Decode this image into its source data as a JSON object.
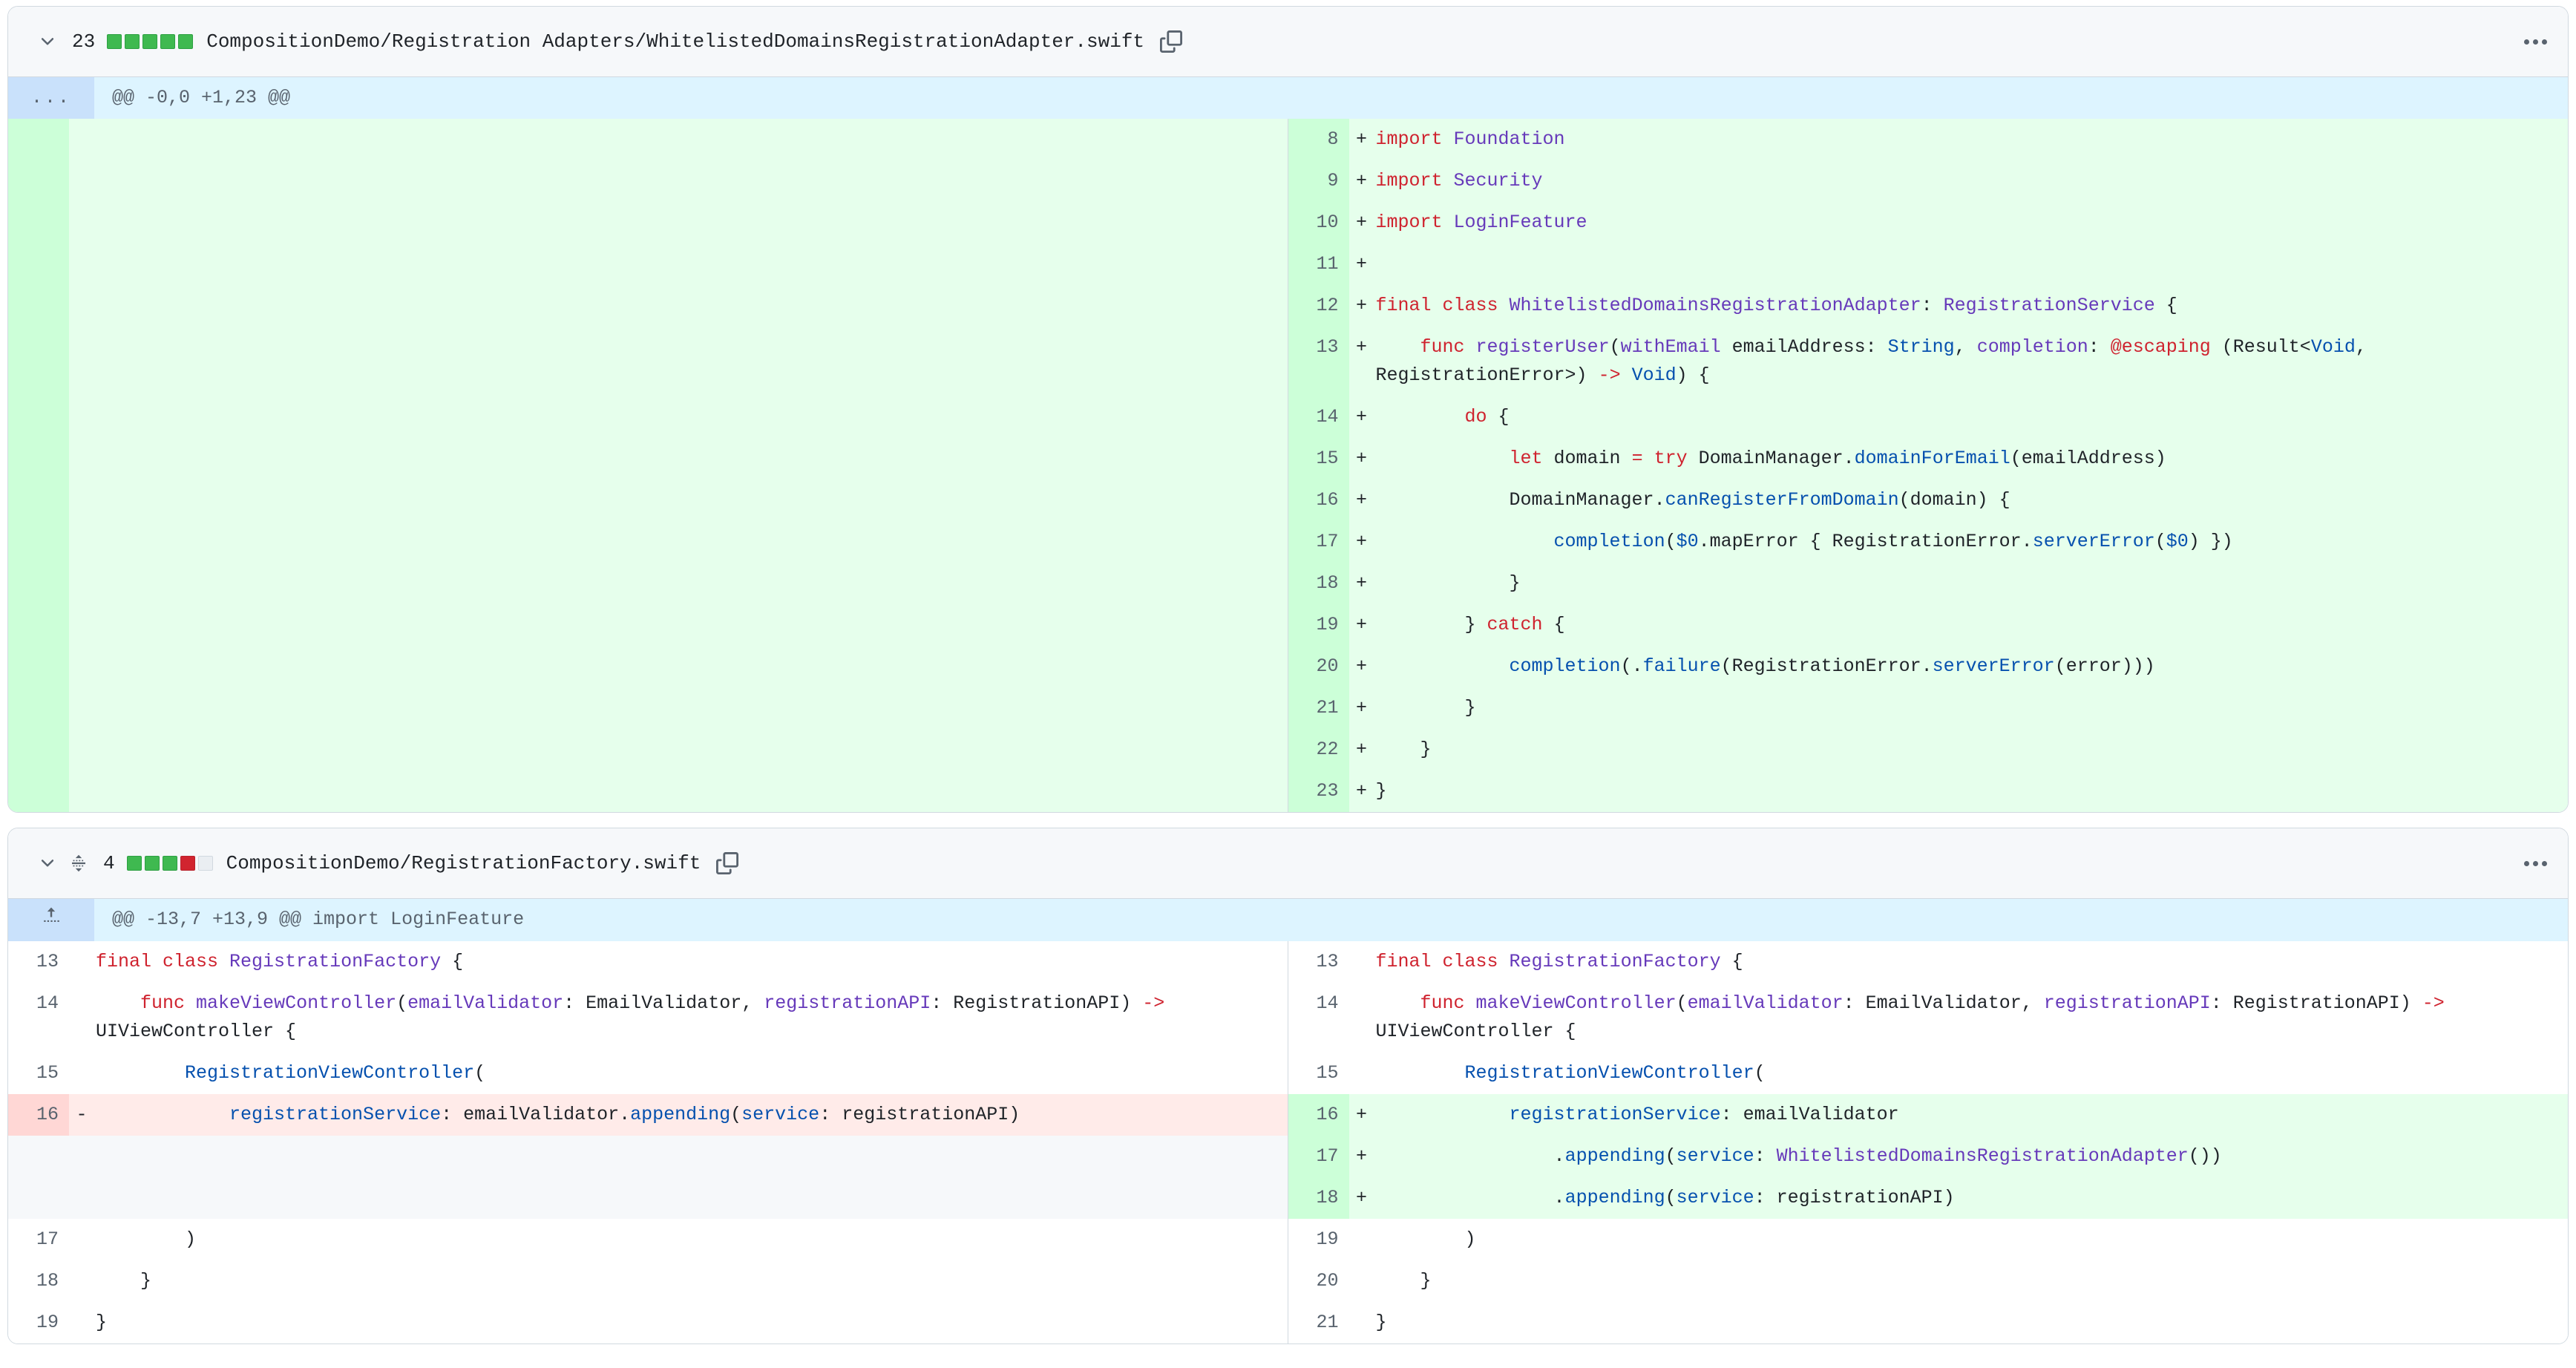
{
  "files": [
    {
      "change_count": "23",
      "path": "CompositionDemo/Registration Adapters/WhitelistedDomainsRegistrationAdapter.swift",
      "diffstat": [
        "add",
        "add",
        "add",
        "add",
        "add"
      ],
      "has_updown": false,
      "hunk": {
        "gutter": "...",
        "text": "@@ -0,0 +1,23 @@"
      },
      "rows": [
        {
          "type": "add",
          "left_num": "",
          "right_num": "8",
          "sign": "+",
          "tokens": [
            {
              "t": "k",
              "v": "import"
            },
            {
              "t": "pl",
              "v": " "
            },
            {
              "t": "t",
              "v": "Foundation"
            }
          ]
        },
        {
          "type": "add",
          "left_num": "",
          "right_num": "9",
          "sign": "+",
          "tokens": [
            {
              "t": "k",
              "v": "import"
            },
            {
              "t": "pl",
              "v": " "
            },
            {
              "t": "t",
              "v": "Security"
            }
          ]
        },
        {
          "type": "add",
          "left_num": "",
          "right_num": "10",
          "sign": "+",
          "tokens": [
            {
              "t": "k",
              "v": "import"
            },
            {
              "t": "pl",
              "v": " "
            },
            {
              "t": "t",
              "v": "LoginFeature"
            }
          ]
        },
        {
          "type": "add",
          "left_num": "",
          "right_num": "11",
          "sign": "+",
          "tokens": [
            {
              "t": "pl",
              "v": ""
            }
          ]
        },
        {
          "type": "add",
          "left_num": "",
          "right_num": "12",
          "sign": "+",
          "tokens": [
            {
              "t": "k",
              "v": "final class"
            },
            {
              "t": "pl",
              "v": " "
            },
            {
              "t": "t",
              "v": "WhitelistedDomainsRegistrationAdapter"
            },
            {
              "t": "pl",
              "v": ": "
            },
            {
              "t": "t",
              "v": "RegistrationService"
            },
            {
              "t": "pl",
              "v": " {"
            }
          ]
        },
        {
          "type": "add",
          "left_num": "",
          "right_num": "13",
          "sign": "+",
          "tokens": [
            {
              "t": "pl",
              "v": "    "
            },
            {
              "t": "k",
              "v": "func"
            },
            {
              "t": "pl",
              "v": " "
            },
            {
              "t": "t",
              "v": "registerUser"
            },
            {
              "t": "pl",
              "v": "("
            },
            {
              "t": "t",
              "v": "withEmail"
            },
            {
              "t": "pl",
              "v": " emailAddress: "
            },
            {
              "t": "ty",
              "v": "String"
            },
            {
              "t": "pl",
              "v": ", "
            },
            {
              "t": "t",
              "v": "completion"
            },
            {
              "t": "pl",
              "v": ": "
            },
            {
              "t": "at",
              "v": "@escaping"
            },
            {
              "t": "pl",
              "v": " (Result<"
            },
            {
              "t": "ty",
              "v": "Void"
            },
            {
              "t": "pl",
              "v": ", RegistrationError>) "
            },
            {
              "t": "op",
              "v": "->"
            },
            {
              "t": "pl",
              "v": " "
            },
            {
              "t": "ty",
              "v": "Void"
            },
            {
              "t": "pl",
              "v": ") {"
            }
          ]
        },
        {
          "type": "add",
          "left_num": "",
          "right_num": "14",
          "sign": "+",
          "tokens": [
            {
              "t": "pl",
              "v": "        "
            },
            {
              "t": "k",
              "v": "do"
            },
            {
              "t": "pl",
              "v": " {"
            }
          ]
        },
        {
          "type": "add",
          "left_num": "",
          "right_num": "15",
          "sign": "+",
          "tokens": [
            {
              "t": "pl",
              "v": "            "
            },
            {
              "t": "k",
              "v": "let"
            },
            {
              "t": "pl",
              "v": " domain "
            },
            {
              "t": "op",
              "v": "="
            },
            {
              "t": "pl",
              "v": " "
            },
            {
              "t": "k",
              "v": "try"
            },
            {
              "t": "pl",
              "v": " DomainManager."
            },
            {
              "t": "fn",
              "v": "domainForEmail"
            },
            {
              "t": "pl",
              "v": "(emailAddress)"
            }
          ]
        },
        {
          "type": "add",
          "left_num": "",
          "right_num": "16",
          "sign": "+",
          "tokens": [
            {
              "t": "pl",
              "v": "            DomainManager."
            },
            {
              "t": "fn",
              "v": "canRegisterFromDomain"
            },
            {
              "t": "pl",
              "v": "(domain) {"
            }
          ]
        },
        {
          "type": "add",
          "left_num": "",
          "right_num": "17",
          "sign": "+",
          "tokens": [
            {
              "t": "pl",
              "v": "                "
            },
            {
              "t": "fn",
              "v": "completion"
            },
            {
              "t": "pl",
              "v": "("
            },
            {
              "t": "fn",
              "v": "$0"
            },
            {
              "t": "pl",
              "v": ".mapError { RegistrationError."
            },
            {
              "t": "fn",
              "v": "serverError"
            },
            {
              "t": "pl",
              "v": "("
            },
            {
              "t": "fn",
              "v": "$0"
            },
            {
              "t": "pl",
              "v": ") })"
            }
          ]
        },
        {
          "type": "add",
          "left_num": "",
          "right_num": "18",
          "sign": "+",
          "tokens": [
            {
              "t": "pl",
              "v": "            }"
            }
          ]
        },
        {
          "type": "add",
          "left_num": "",
          "right_num": "19",
          "sign": "+",
          "tokens": [
            {
              "t": "pl",
              "v": "        } "
            },
            {
              "t": "k",
              "v": "catch"
            },
            {
              "t": "pl",
              "v": " {"
            }
          ]
        },
        {
          "type": "add",
          "left_num": "",
          "right_num": "20",
          "sign": "+",
          "tokens": [
            {
              "t": "pl",
              "v": "            "
            },
            {
              "t": "fn",
              "v": "completion"
            },
            {
              "t": "pl",
              "v": "(."
            },
            {
              "t": "fn",
              "v": "failure"
            },
            {
              "t": "pl",
              "v": "(RegistrationError."
            },
            {
              "t": "fn",
              "v": "serverError"
            },
            {
              "t": "pl",
              "v": "(error)))"
            }
          ]
        },
        {
          "type": "add",
          "left_num": "",
          "right_num": "21",
          "sign": "+",
          "tokens": [
            {
              "t": "pl",
              "v": "        }"
            }
          ]
        },
        {
          "type": "add",
          "left_num": "",
          "right_num": "22",
          "sign": "+",
          "tokens": [
            {
              "t": "pl",
              "v": "    }"
            }
          ]
        },
        {
          "type": "add",
          "left_num": "",
          "right_num": "23",
          "sign": "+",
          "tokens": [
            {
              "t": "pl",
              "v": "}"
            }
          ]
        }
      ]
    },
    {
      "change_count": "4",
      "path": "CompositionDemo/RegistrationFactory.swift",
      "diffstat": [
        "add",
        "add",
        "add",
        "del",
        "neutral"
      ],
      "has_updown": true,
      "hunk": {
        "gutter": "expand-up",
        "text": "@@ -13,7 +13,9 @@ import LoginFeature"
      },
      "rows": [
        {
          "type": "ctx",
          "left_num": "13",
          "right_num": "13",
          "sign": "",
          "tokens": [
            {
              "t": "k",
              "v": "final class"
            },
            {
              "t": "pl",
              "v": " "
            },
            {
              "t": "t",
              "v": "RegistrationFactory"
            },
            {
              "t": "pl",
              "v": " {"
            }
          ]
        },
        {
          "type": "ctx",
          "left_num": "14",
          "right_num": "14",
          "sign": "",
          "tokens": [
            {
              "t": "pl",
              "v": "    "
            },
            {
              "t": "k",
              "v": "func"
            },
            {
              "t": "pl",
              "v": " "
            },
            {
              "t": "t",
              "v": "makeViewController"
            },
            {
              "t": "pl",
              "v": "("
            },
            {
              "t": "t",
              "v": "emailValidator"
            },
            {
              "t": "pl",
              "v": ": EmailValidator, "
            },
            {
              "t": "t",
              "v": "registrationAPI"
            },
            {
              "t": "pl",
              "v": ": RegistrationAPI) "
            },
            {
              "t": "op",
              "v": "->"
            },
            {
              "t": "pl",
              "v": " UIViewController {"
            }
          ]
        },
        {
          "type": "ctx",
          "left_num": "15",
          "right_num": "15",
          "sign": "",
          "tokens": [
            {
              "t": "pl",
              "v": "        "
            },
            {
              "t": "fn",
              "v": "RegistrationViewController"
            },
            {
              "t": "pl",
              "v": "("
            }
          ]
        },
        {
          "type": "change",
          "left_num": "16",
          "right_num": "16",
          "left_sign": "-",
          "right_sign": "+",
          "left_tokens": [
            {
              "t": "pl",
              "v": "            "
            },
            {
              "t": "fn",
              "v": "registrationService"
            },
            {
              "t": "pl",
              "v": ": emailValidator."
            },
            {
              "t": "fn",
              "v": "appending"
            },
            {
              "t": "pl",
              "v": "("
            },
            {
              "t": "fn",
              "v": "service"
            },
            {
              "t": "pl",
              "v": ": registrationAPI)"
            }
          ],
          "right_tokens": [
            {
              "t": "pl",
              "v": "            "
            },
            {
              "t": "fn",
              "v": "registrationService"
            },
            {
              "t": "pl",
              "v": ": emailValidator"
            }
          ]
        },
        {
          "type": "add-only",
          "right_num": "17",
          "right_sign": "+",
          "right_tokens": [
            {
              "t": "pl",
              "v": "                ."
            },
            {
              "t": "fn",
              "v": "appending"
            },
            {
              "t": "pl",
              "v": "("
            },
            {
              "t": "fn",
              "v": "service"
            },
            {
              "t": "pl",
              "v": ": "
            },
            {
              "t": "t",
              "v": "WhitelistedDomainsRegistrationAdapter"
            },
            {
              "t": "pl",
              "v": "())"
            }
          ]
        },
        {
          "type": "add-only",
          "right_num": "18",
          "right_sign": "+",
          "right_tokens": [
            {
              "t": "pl",
              "v": "                ."
            },
            {
              "t": "fn",
              "v": "appending"
            },
            {
              "t": "pl",
              "v": "("
            },
            {
              "t": "fn",
              "v": "service"
            },
            {
              "t": "pl",
              "v": ": registrationAPI)"
            }
          ]
        },
        {
          "type": "ctx",
          "left_num": "17",
          "right_num": "19",
          "sign": "",
          "tokens": [
            {
              "t": "pl",
              "v": "        )"
            }
          ]
        },
        {
          "type": "ctx",
          "left_num": "18",
          "right_num": "20",
          "sign": "",
          "tokens": [
            {
              "t": "pl",
              "v": "    }"
            }
          ]
        },
        {
          "type": "ctx",
          "left_num": "19",
          "right_num": "21",
          "sign": "",
          "tokens": [
            {
              "t": "pl",
              "v": "}"
            }
          ]
        }
      ]
    }
  ],
  "icons": {
    "chevron_down": "chevron-down-icon",
    "updown": "expand-updown-icon",
    "copy": "copy-icon",
    "kebab": "kebab-menu-icon",
    "expand_up": "expand-up-icon"
  },
  "colors": {
    "addition_bg": "#e6ffec",
    "addition_gutter": "#ccffd8",
    "deletion_bg": "#ffebe9",
    "deletion_gutter": "#ffd7d5",
    "hunk_bg": "#ddf4ff",
    "hunk_gutter": "#c9e1fb",
    "header_bg": "#f6f8fa",
    "border": "#d1d9e0",
    "keyword": "#cf222e",
    "type": "#6639ba",
    "function": "#0550ae",
    "text": "#1f2328",
    "muted": "#59636e"
  }
}
